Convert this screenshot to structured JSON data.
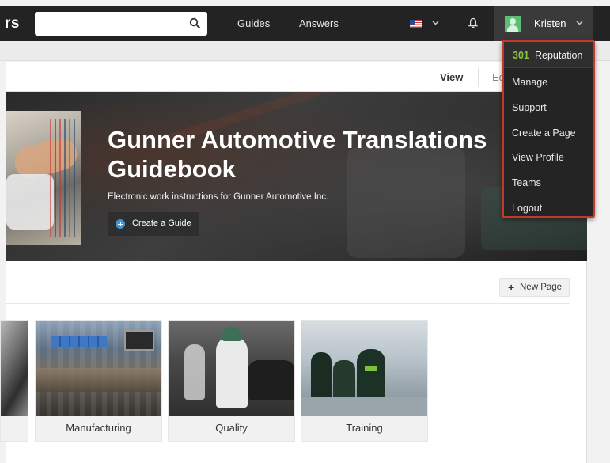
{
  "header": {
    "logo_fragment": "rs",
    "search": {
      "value": "",
      "placeholder": ""
    },
    "nav": {
      "guides": "Guides",
      "answers": "Answers"
    },
    "user": {
      "name": "Kristen"
    }
  },
  "tabs": {
    "view": "View",
    "edit": "Ed"
  },
  "hero": {
    "title": "Gunner Automotive Translations Guidebook",
    "subtitle": "Electronic work instructions for Gunner Automotive Inc.",
    "create_button": "Create a Guide"
  },
  "toolbar": {
    "new_page": "New Page"
  },
  "categories": [
    {
      "name": ""
    },
    {
      "name": "Manufacturing"
    },
    {
      "name": "Quality"
    },
    {
      "name": "Training"
    }
  ],
  "user_menu": {
    "reputation_value": "301",
    "reputation_label": "Reputation",
    "items": [
      {
        "label": "Manage"
      },
      {
        "label": "Support"
      },
      {
        "label": "Create a Page"
      },
      {
        "label": "View Profile"
      },
      {
        "label": "Teams"
      },
      {
        "label": "Logout"
      }
    ]
  },
  "colors": {
    "nav_bg": "#232323",
    "highlight_border": "#c0392b",
    "reputation_green": "#8ac33f",
    "create_icon_blue": "#3c95d9"
  }
}
